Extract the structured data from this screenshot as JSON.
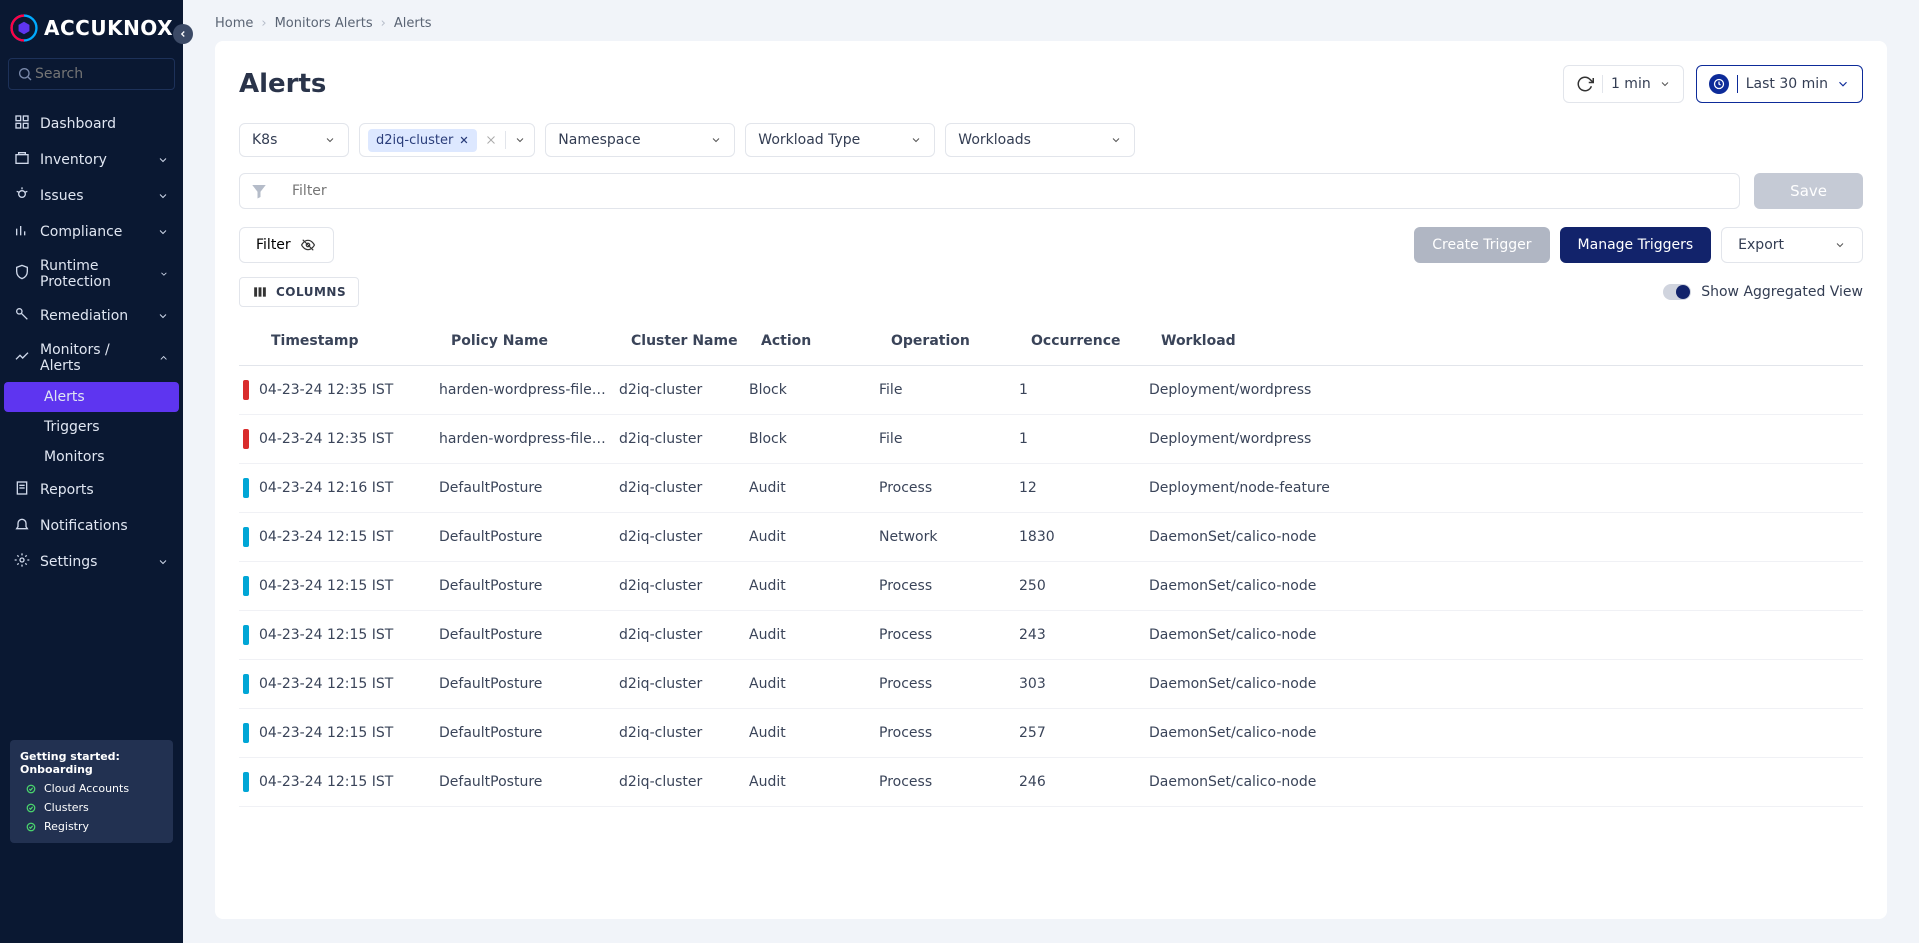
{
  "brand": "ACCUKNOX",
  "search_placeholder": "Search",
  "nav": [
    {
      "label": "Dashboard",
      "expandable": false
    },
    {
      "label": "Inventory",
      "expandable": true
    },
    {
      "label": "Issues",
      "expandable": true
    },
    {
      "label": "Compliance",
      "expandable": true
    },
    {
      "label": "Runtime Protection",
      "expandable": true
    },
    {
      "label": "Remediation",
      "expandable": true
    },
    {
      "label": "Monitors / Alerts",
      "expandable": true,
      "expanded": true,
      "children": [
        {
          "label": "Alerts",
          "active": true
        },
        {
          "label": "Triggers"
        },
        {
          "label": "Monitors"
        }
      ]
    },
    {
      "label": "Reports",
      "expandable": false
    },
    {
      "label": "Notifications",
      "expandable": false
    },
    {
      "label": "Settings",
      "expandable": true
    }
  ],
  "onboard": {
    "title": "Getting started: Onboarding",
    "steps": [
      "Cloud Accounts",
      "Clusters",
      "Registry"
    ]
  },
  "breadcrumbs": [
    "Home",
    "Monitors Alerts",
    "Alerts"
  ],
  "page_title": "Alerts",
  "refresh_interval": "1 min",
  "time_range": "Last 30 min",
  "filters": {
    "env": "K8s",
    "cluster_chip": "d2iq-cluster",
    "namespace_label": "Namespace",
    "workload_type_label": "Workload Type",
    "workloads_label": "Workloads"
  },
  "filter_input_placeholder": "Filter",
  "save_label": "Save",
  "filter_btn": "Filter",
  "create_trigger": "Create Trigger",
  "manage_triggers": "Manage Triggers",
  "export_label": "Export",
  "columns_label": "COLUMNS",
  "aggregated_label": "Show Aggregated View",
  "table": {
    "headers": [
      "Timestamp",
      "Policy Name",
      "Cluster Name",
      "Action",
      "Operation",
      "Occurrence",
      "Workload"
    ],
    "rows": [
      {
        "sev": "red",
        "ts": "04-23-24 12:35 IST",
        "policy": "harden-wordpress-file-…",
        "cluster": "d2iq-cluster",
        "action": "Block",
        "op": "File",
        "occ": "1",
        "wl": "Deployment/wordpress"
      },
      {
        "sev": "red",
        "ts": "04-23-24 12:35 IST",
        "policy": "harden-wordpress-file-…",
        "cluster": "d2iq-cluster",
        "action": "Block",
        "op": "File",
        "occ": "1",
        "wl": "Deployment/wordpress"
      },
      {
        "sev": "cyan",
        "ts": "04-23-24 12:16 IST",
        "policy": "DefaultPosture",
        "cluster": "d2iq-cluster",
        "action": "Audit",
        "op": "Process",
        "occ": "12",
        "wl": "Deployment/node-feature"
      },
      {
        "sev": "cyan",
        "ts": "04-23-24 12:15 IST",
        "policy": "DefaultPosture",
        "cluster": "d2iq-cluster",
        "action": "Audit",
        "op": "Network",
        "occ": "1830",
        "wl": "DaemonSet/calico-node"
      },
      {
        "sev": "cyan",
        "ts": "04-23-24 12:15 IST",
        "policy": "DefaultPosture",
        "cluster": "d2iq-cluster",
        "action": "Audit",
        "op": "Process",
        "occ": "250",
        "wl": "DaemonSet/calico-node"
      },
      {
        "sev": "cyan",
        "ts": "04-23-24 12:15 IST",
        "policy": "DefaultPosture",
        "cluster": "d2iq-cluster",
        "action": "Audit",
        "op": "Process",
        "occ": "243",
        "wl": "DaemonSet/calico-node"
      },
      {
        "sev": "cyan",
        "ts": "04-23-24 12:15 IST",
        "policy": "DefaultPosture",
        "cluster": "d2iq-cluster",
        "action": "Audit",
        "op": "Process",
        "occ": "303",
        "wl": "DaemonSet/calico-node"
      },
      {
        "sev": "cyan",
        "ts": "04-23-24 12:15 IST",
        "policy": "DefaultPosture",
        "cluster": "d2iq-cluster",
        "action": "Audit",
        "op": "Process",
        "occ": "257",
        "wl": "DaemonSet/calico-node"
      },
      {
        "sev": "cyan",
        "ts": "04-23-24 12:15 IST",
        "policy": "DefaultPosture",
        "cluster": "d2iq-cluster",
        "action": "Audit",
        "op": "Process",
        "occ": "246",
        "wl": "DaemonSet/calico-node"
      }
    ]
  }
}
